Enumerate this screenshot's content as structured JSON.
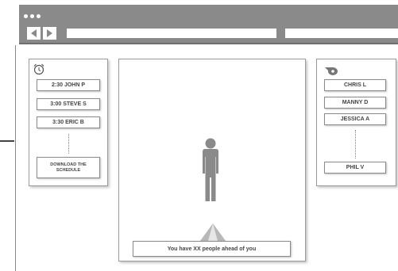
{
  "browser": {
    "window_dots": [
      "dot-1",
      "dot-2",
      "dot-3"
    ],
    "back_icon": "chevron-left-icon",
    "forward_icon": "chevron-right-icon"
  },
  "left_panel": {
    "icon": "alarm-clock-icon",
    "items": [
      "2:30 JOHN P",
      "3:00 STEVE S",
      "3:30 ERIC B"
    ],
    "download_label_line1": "DOWNLOAD THE",
    "download_label_line2": "SCHEDULE"
  },
  "right_panel": {
    "icon": "whistle-icon",
    "items": [
      "CHRIS L",
      "MANNY D",
      "JESSICA A"
    ],
    "last_item": "PHIL V"
  },
  "center": {
    "person_icon": "person-icon",
    "indicator_icon": "up-arrow-icon",
    "queue_message": "You have XX people ahead of you"
  },
  "colors": {
    "chrome": "#8a8a8a",
    "figure": "#8a8a8a",
    "text": "#444444"
  }
}
